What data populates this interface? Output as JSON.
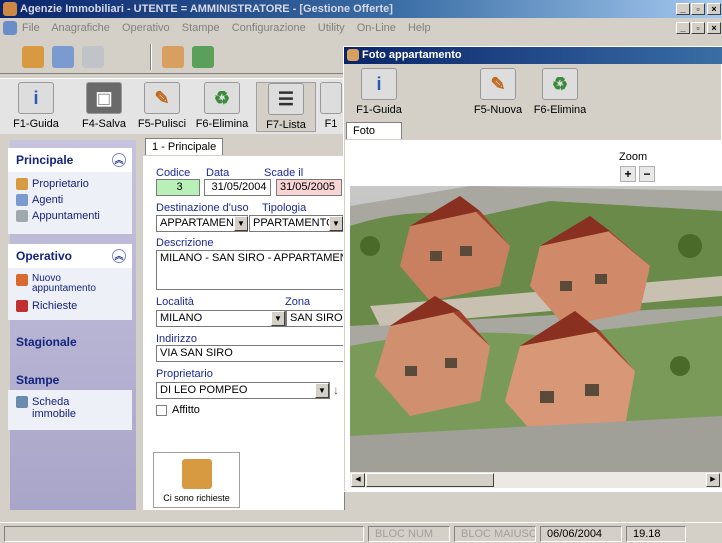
{
  "window": {
    "title": "Agenzie Immobiliari - UTENTE = AMMINISTRATORE  - [Gestione Offerte]",
    "controls": [
      "_",
      "▫",
      "×"
    ]
  },
  "menu": [
    "File",
    "Anagrafiche",
    "Operativo",
    "Stampe",
    "Configurazione",
    "Utility",
    "On-Line",
    "Help"
  ],
  "main_toolbar": {
    "buttons": [
      {
        "label": "F1-Guida",
        "icon": "info-icon"
      },
      {
        "label": "F4-Salva",
        "icon": "floppy-icon"
      },
      {
        "label": "F5-Pulisci",
        "icon": "pencil-icon"
      },
      {
        "label": "F6-Elimina",
        "icon": "recycle-bin-icon"
      },
      {
        "label": "F7-Lista",
        "icon": "list-icon"
      },
      {
        "label": "F1",
        "icon": "more-icon"
      }
    ]
  },
  "sidebar": {
    "principale": {
      "title": "Principale",
      "items": [
        "Proprietario",
        "Agenti",
        "Appuntamenti"
      ]
    },
    "operativo": {
      "title": "Operativo",
      "items": [
        "Nuovo appuntamento",
        "Richieste"
      ]
    },
    "stagionale": {
      "title": "Stagionale"
    },
    "stampe": {
      "title": "Stampe",
      "items": [
        "Scheda immobile"
      ]
    }
  },
  "form": {
    "tab": "1 - Principale",
    "codice_label": "Codice",
    "codice": "3",
    "data_label": "Data",
    "data": "31/05/2004",
    "scade_label": "Scade il",
    "scade": "31/05/2005",
    "destinazione_label": "Destinazione d'uso",
    "destinazione": "APPARTAMENT",
    "tipologia_label": "Tipologia",
    "tipologia": "PPARTAMENTO",
    "descrizione_label": "Descrizione",
    "descrizione": "MILANO - SAN SIRO - APPARTAMENTO E",
    "localita_label": "Località",
    "localita": "MILANO",
    "zona_label": "Zona",
    "zona": "SAN SIRO",
    "indirizzo_label": "Indirizzo",
    "indirizzo": "VIA SAN SIRO",
    "proprietario_label": "Proprietario",
    "proprietario": "DI LEO POMPEO",
    "affitto_label": "Affitto",
    "richieste_button": "Ci sono richieste"
  },
  "photo_window": {
    "title": "Foto appartamento",
    "buttons": [
      {
        "label": "F1-Guida",
        "icon": "info-icon"
      },
      {
        "label": "F5-Nuova",
        "icon": "pencil-icon"
      },
      {
        "label": "F6-Elimina",
        "icon": "recycle-bin-icon"
      }
    ],
    "tab": "Foto",
    "zoom_label": "Zoom",
    "zoom_in": "+",
    "zoom_out": "−"
  },
  "statusbar": {
    "num": "BLOC NUM",
    "caps": "BLOC MAIUSC",
    "date": "06/06/2004",
    "time": "19.18"
  }
}
